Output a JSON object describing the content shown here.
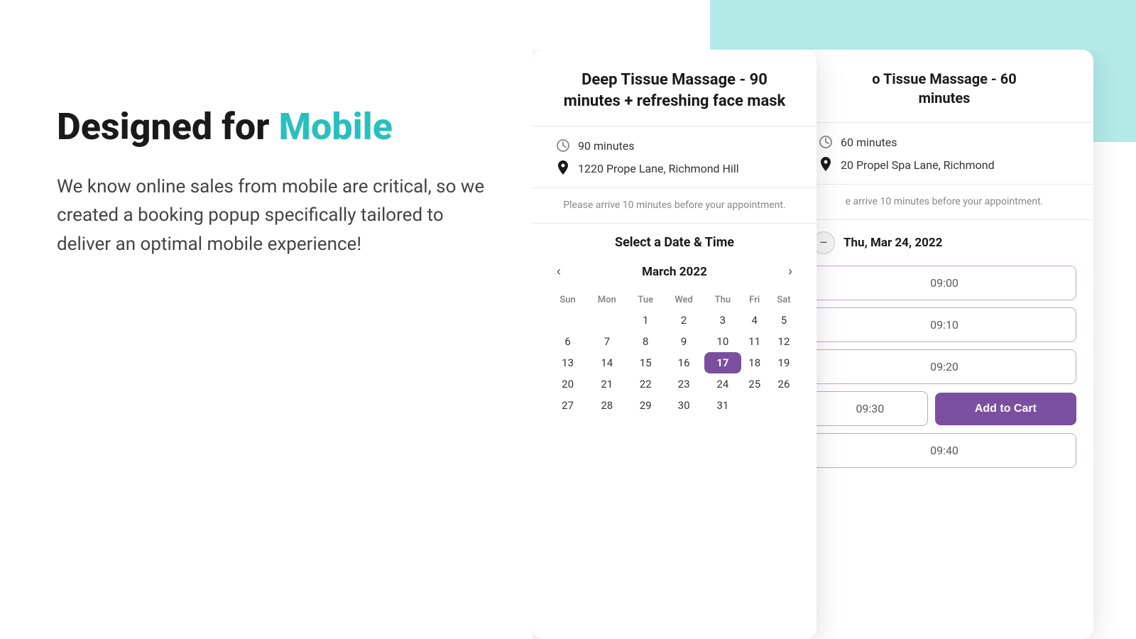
{
  "background": {
    "teal_color": "#b2eae8"
  },
  "left": {
    "headline_part1": "Designed for ",
    "headline_part2": "Mobile",
    "description": "We know online sales from mobile are critical, so we created a booking popup specifically tailored to deliver an optimal mobile experience!"
  },
  "card1": {
    "title": "Deep Tissue Massage - 90 minutes + refreshing face mask",
    "duration": "90 minutes",
    "location": "1220 Prope Lane, Richmond Hill",
    "arrival_note": "Please arrive 10 minutes before your appointment.",
    "calendar_title": "Select a Date & Time",
    "month_year": "March 2022",
    "days_of_week": [
      "Sun",
      "Mon",
      "Tue",
      "Wed",
      "Thu",
      "Fri",
      "Sat"
    ],
    "selected_day": 17,
    "weeks": [
      [
        null,
        null,
        1,
        2,
        3,
        4,
        5
      ],
      [
        6,
        7,
        8,
        9,
        10,
        11,
        12
      ],
      [
        13,
        14,
        15,
        16,
        17,
        18,
        19
      ],
      [
        20,
        21,
        22,
        23,
        24,
        25,
        26
      ],
      [
        27,
        28,
        29,
        30,
        31,
        null,
        null
      ]
    ]
  },
  "card2": {
    "title_prefix": "o Tissue Massage - 60",
    "title_suffix": "minutes",
    "duration": "60 minutes",
    "location": "20 Propel Spa Lane, Richmond",
    "arrival_note": "e arrive 10 minutes before your appointment.",
    "selected_date": "Thu, Mar 24, 2022",
    "time_slots": [
      "09:00",
      "09:10",
      "09:20",
      "09:30",
      "09:40"
    ],
    "add_to_cart_label": "Add to Cart"
  }
}
